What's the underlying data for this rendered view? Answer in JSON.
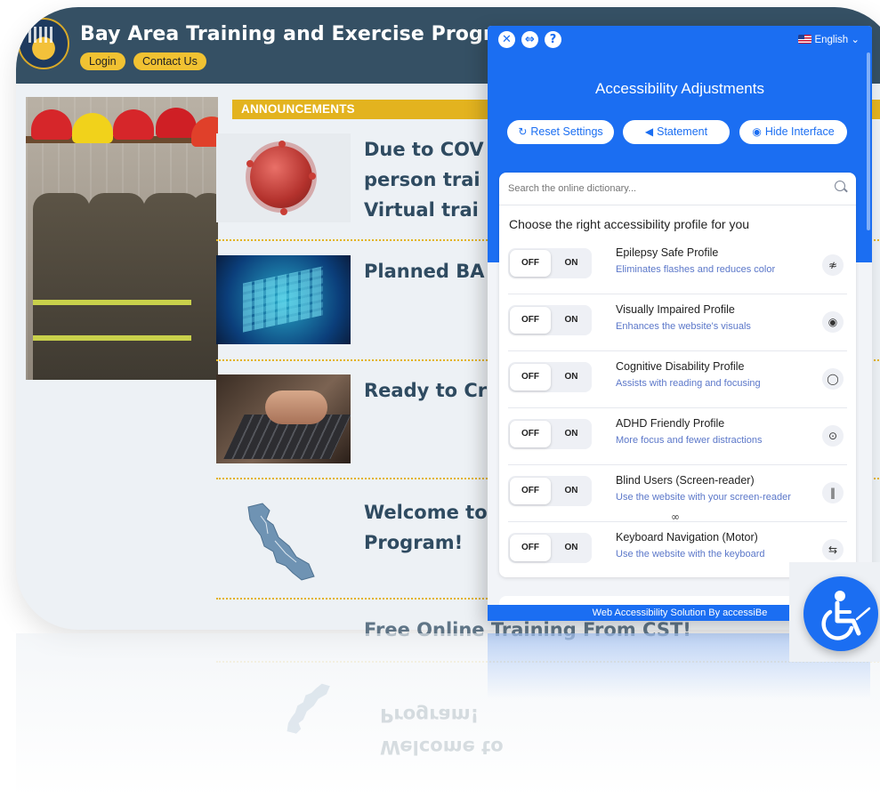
{
  "site": {
    "title": "Bay Area Training and Exercise Program",
    "login_label": "Login",
    "contact_label": "Contact Us",
    "announcements_heading": "ANNOUNCEMENTS",
    "announcements": [
      {
        "title_line1": "Due to COV",
        "title_line2": "person trai",
        "title_line3": "Virtual trai",
        "thumb": "coronavirus-image"
      },
      {
        "title_line1": "Planned BA",
        "thumb": "data-visual-image"
      },
      {
        "title_line1": "Ready to Cr",
        "thumb": "laptop-typing-image"
      },
      {
        "title_line1": "Welcome to",
        "title_line2": "Program!",
        "thumb": "bay-area-map-image"
      },
      {
        "title_line1": "Free Online Training From CST!"
      }
    ]
  },
  "accessibility": {
    "language": "English",
    "heading": "Accessibility Adjustments",
    "buttons": {
      "reset": "Reset Settings",
      "statement": "Statement",
      "hide": "Hide Interface"
    },
    "search_placeholder": "Search the online dictionary...",
    "choose_text": "Choose the right accessibility profile for you",
    "off_label": "OFF",
    "on_label": "ON",
    "profiles": [
      {
        "name": "Epilepsy Safe Profile",
        "desc": "Eliminates flashes and reduces color",
        "icon": "no-flash-icon",
        "glyph": "≉"
      },
      {
        "name": "Visually Impaired Profile",
        "desc": "Enhances the website's visuals",
        "icon": "eye-icon",
        "glyph": "◉"
      },
      {
        "name": "Cognitive Disability Profile",
        "desc": "Assists with reading and focusing",
        "icon": "circle-icon",
        "glyph": "◯"
      },
      {
        "name": "ADHD Friendly Profile",
        "desc": "More focus and fewer distractions",
        "icon": "focus-icon",
        "glyph": "⊙"
      },
      {
        "name": "Blind Users (Screen-reader)",
        "desc": "Use the website with your screen-reader",
        "icon": "audio-wave-icon",
        "glyph": "‖"
      },
      {
        "name": "Keyboard Navigation (Motor)",
        "desc": "Use the website with the keyboard",
        "icon": "arrows-icon",
        "glyph": "⇆"
      }
    ],
    "footer": "Web Accessibility Solution By accessiBe",
    "colors": {
      "primary": "#1b6ef2",
      "accent": "#e3b31f",
      "site_header": "#355064"
    }
  }
}
